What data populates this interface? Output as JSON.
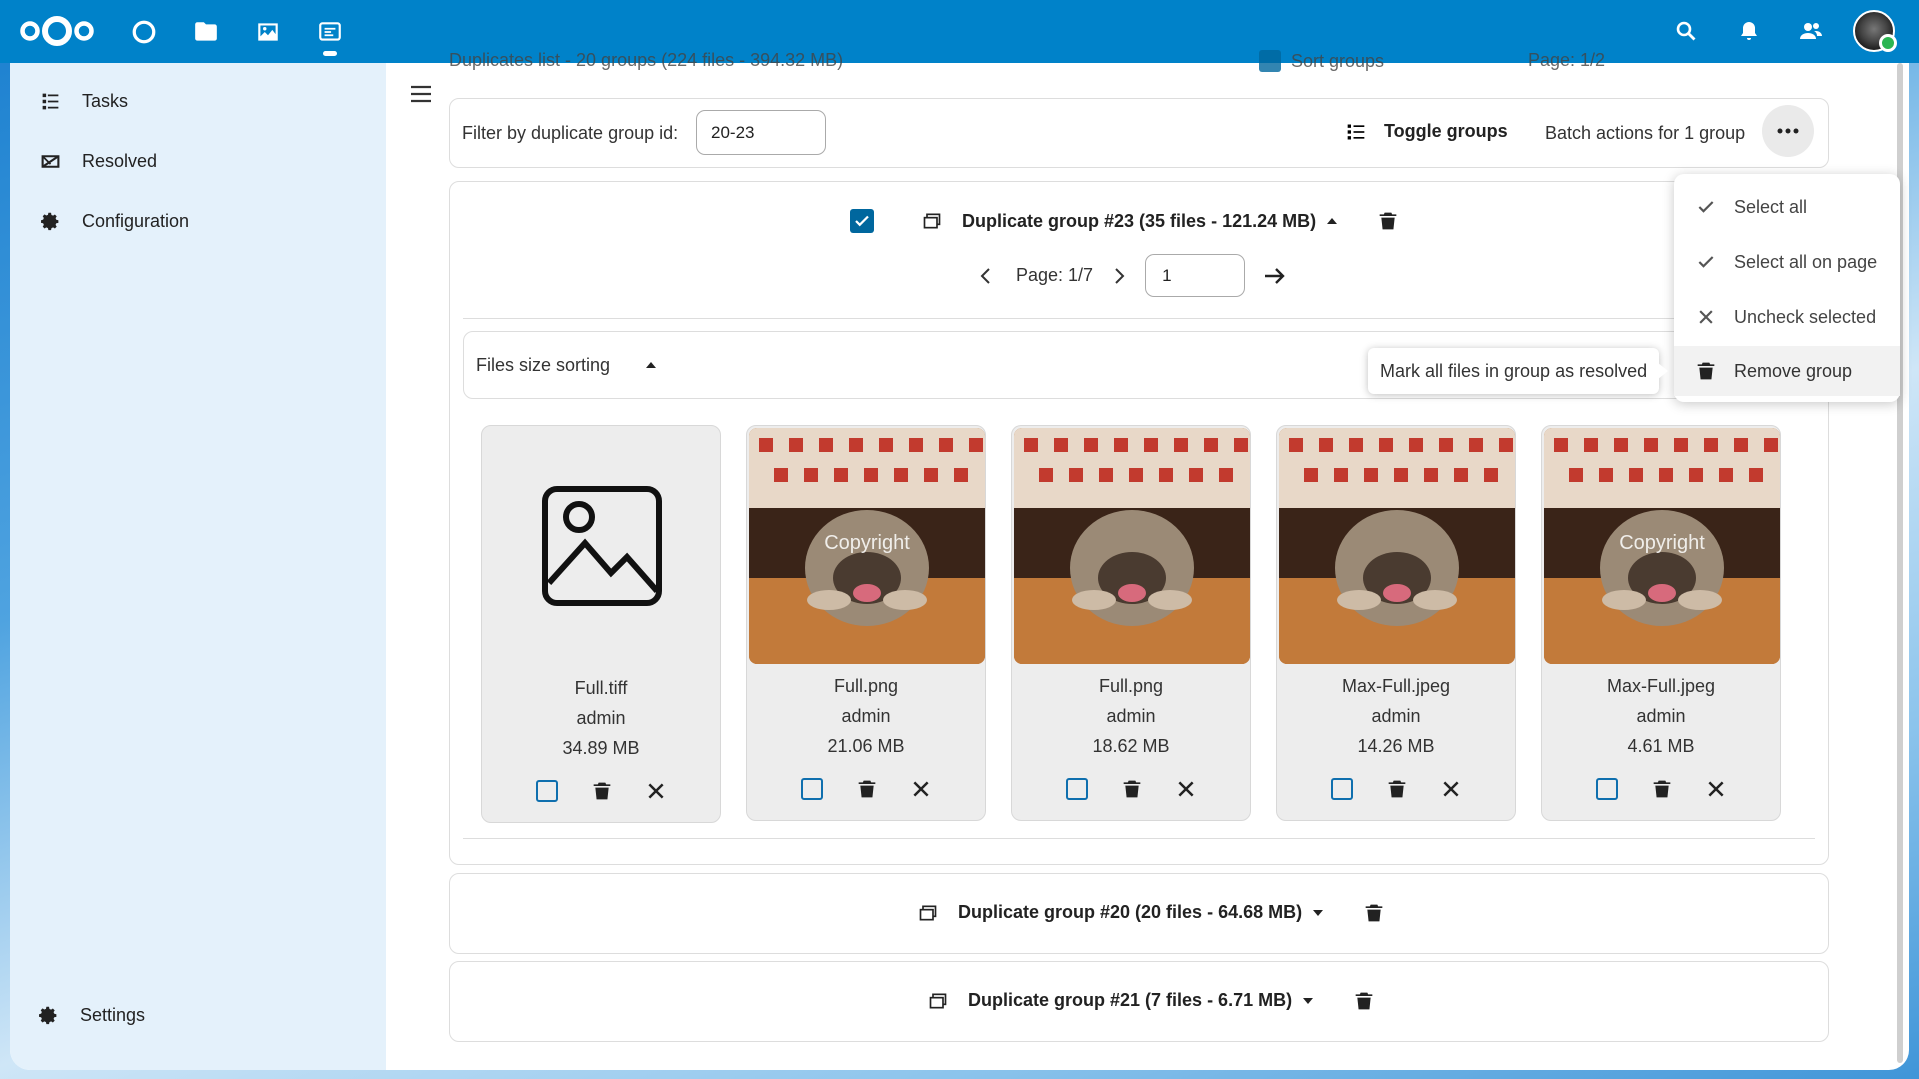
{
  "nav": {
    "apps": [
      "dashboard",
      "files",
      "photos",
      "duplicates"
    ],
    "right": [
      "search",
      "notifications",
      "contacts",
      "user-menu"
    ]
  },
  "sidebar": {
    "items": [
      {
        "label": "Tasks",
        "icon": "tasks-icon"
      },
      {
        "label": "Resolved",
        "icon": "resolved-icon"
      },
      {
        "label": "Configuration",
        "icon": "gear-icon"
      }
    ],
    "settings_label": "Settings"
  },
  "header": {
    "list_title": "Duplicates list - 20 groups (224 files - 394.32 MB)",
    "sort_label": "Sort groups",
    "page_label": "Page: 1/2"
  },
  "filter": {
    "label": "Filter by duplicate group id:",
    "value": "20-23"
  },
  "toolbar": {
    "toggle_label": "Toggle groups",
    "batch_label": "Batch actions for 1 group"
  },
  "group_open": {
    "title": "Duplicate group #23 (35 files - 121.24 MB)",
    "page_label": "Page: 1/7",
    "page_input": "1",
    "sort_label": "Files size sorting",
    "checked": true
  },
  "files": [
    {
      "name": "Full.tiff",
      "user": "admin",
      "size": "34.89 MB",
      "preview": "placeholder"
    },
    {
      "name": "Full.png",
      "user": "admin",
      "size": "21.06 MB",
      "preview": "dog",
      "watermark": "Copyright"
    },
    {
      "name": "Full.png",
      "user": "admin",
      "size": "18.62 MB",
      "preview": "dog"
    },
    {
      "name": "Max-Full.jpeg",
      "user": "admin",
      "size": "14.26 MB",
      "preview": "dog"
    },
    {
      "name": "Max-Full.jpeg",
      "user": "admin",
      "size": "4.61 MB",
      "preview": "dog",
      "watermark": "Copyright"
    }
  ],
  "groups_collapsed": [
    {
      "title": "Duplicate group #20 (20 files - 64.68 MB)"
    },
    {
      "title": "Duplicate group #21 (7 files - 6.71 MB)"
    }
  ],
  "dropdown": {
    "items": [
      {
        "label": "Select all",
        "icon": "check-icon"
      },
      {
        "label": "Select all on page",
        "icon": "check-icon"
      },
      {
        "label": "Uncheck selected",
        "icon": "close-icon"
      },
      {
        "label": "Remove group",
        "icon": "trash-icon"
      }
    ]
  },
  "tooltip": {
    "text": "Mark all files in group as resolved"
  },
  "colors": {
    "header": "#0082c9",
    "sidebar": "#e4f1fb",
    "checkbox": "#00679e"
  }
}
